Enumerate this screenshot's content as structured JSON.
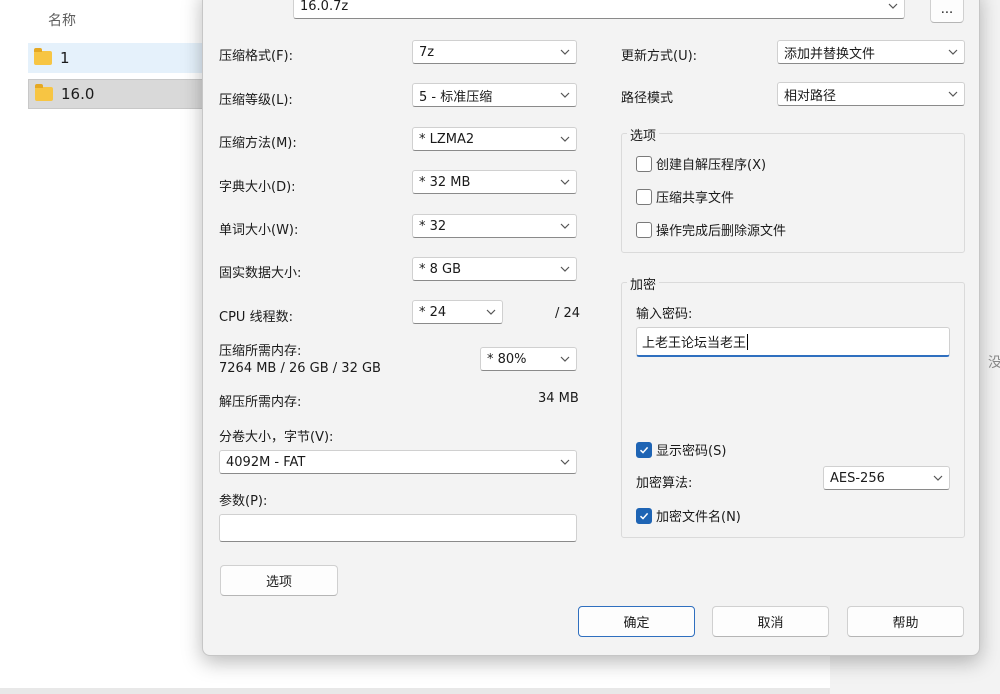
{
  "explorer": {
    "column_header": "名称",
    "files": [
      {
        "name": "1"
      },
      {
        "name": "16.0"
      }
    ],
    "right_pane_cut_text": "没"
  },
  "dialog": {
    "archive_name": "16.0.7z",
    "browse_button": "...",
    "left": {
      "format_label": "压缩格式(F):",
      "format_value": "7z",
      "level_label": "压缩等级(L):",
      "level_value": "5 - 标准压缩",
      "method_label": "压缩方法(M):",
      "method_value": "*  LZMA2",
      "dict_label": "字典大小(D):",
      "dict_value": "*  32 MB",
      "word_label": "单词大小(W):",
      "word_value": "*  32",
      "solid_label": "固实数据大小:",
      "solid_value": "*  8 GB",
      "threads_label": "CPU 线程数:",
      "threads_value": "*  24",
      "threads_max": "/ 24",
      "mem_comp_label": "压缩所需内存:",
      "mem_comp_value": "7264 MB / 26 GB / 32 GB",
      "mem_comp_percent": "*  80%",
      "mem_decomp_label": "解压所需内存:",
      "mem_decomp_value": "34 MB",
      "volume_label": "分卷大小，字节(V):",
      "volume_value": "4092M - FAT",
      "params_label": "参数(P):",
      "params_value": "",
      "options_button": "选项"
    },
    "right": {
      "update_label": "更新方式(U):",
      "update_value": "添加并替换文件",
      "path_label": "路径模式",
      "path_value": "相对路径",
      "options_group": "选项",
      "opt_sfx": "创建自解压程序(X)",
      "opt_shared": "压缩共享文件",
      "opt_delete": "操作完成后删除源文件",
      "encrypt_group": "加密",
      "enter_password_label": "输入密码:",
      "password_value": "上老王论坛当老王",
      "show_password": "显示密码(S)",
      "encrypt_method_label": "加密算法:",
      "encrypt_method_value": "AES-256",
      "encrypt_names": "加密文件名(N)"
    },
    "buttons": {
      "ok": "确定",
      "cancel": "取消",
      "help": "帮助"
    },
    "checkbox_states": {
      "sfx": false,
      "shared": false,
      "delete": false,
      "show_password": true,
      "encrypt_names": true
    },
    "colors": {
      "accent": "#1e64b4",
      "folder": "#f7c543"
    }
  }
}
